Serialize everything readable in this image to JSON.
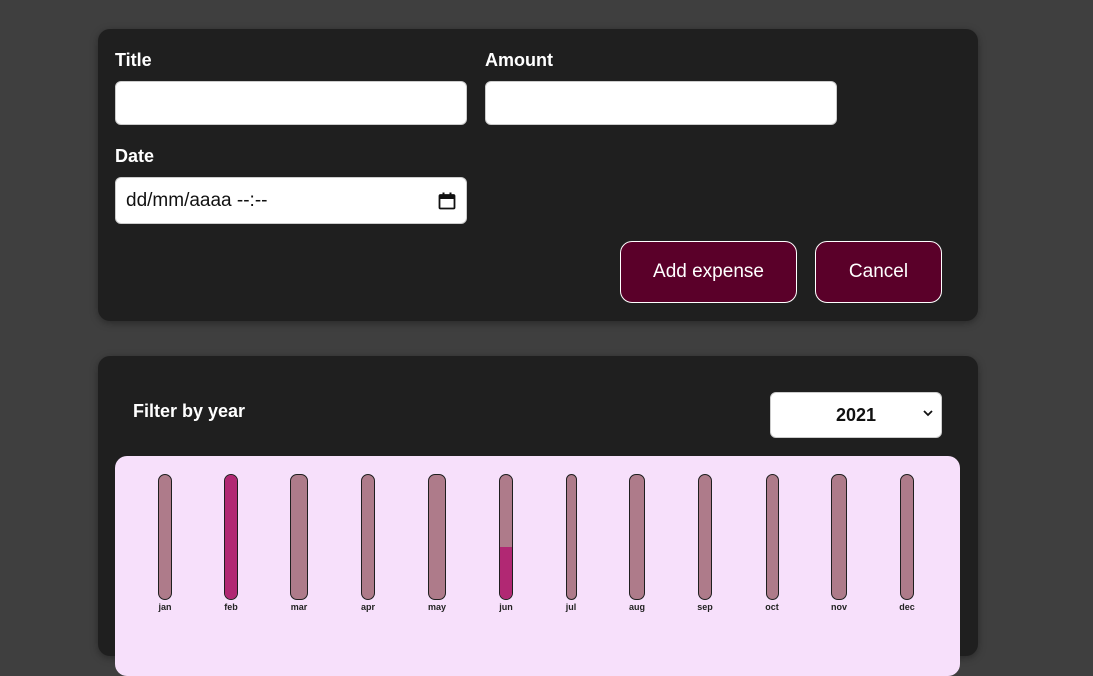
{
  "form": {
    "title_label": "Title",
    "title_value": "",
    "amount_label": "Amount",
    "amount_value": "",
    "date_label": "Date",
    "date_placeholder": "dd/mm/aaaa --:--",
    "add_button": "Add expense",
    "cancel_button": "Cancel"
  },
  "filter": {
    "label": "Filter by year",
    "selected_year": "2021"
  },
  "colors": {
    "accent": "#5a0029",
    "bar_fill": "#b12873",
    "bar_empty": "#ae7b8a",
    "chart_bg": "#f7e0fb"
  },
  "chart_data": {
    "type": "bar",
    "categories": [
      "jan",
      "feb",
      "mar",
      "apr",
      "may",
      "jun",
      "jul",
      "aug",
      "sep",
      "oct",
      "nov",
      "dec"
    ],
    "values": [
      0,
      1.0,
      0,
      0,
      0,
      0.42,
      0,
      0,
      0,
      0,
      0,
      0
    ],
    "ylim": [
      0,
      1
    ]
  }
}
